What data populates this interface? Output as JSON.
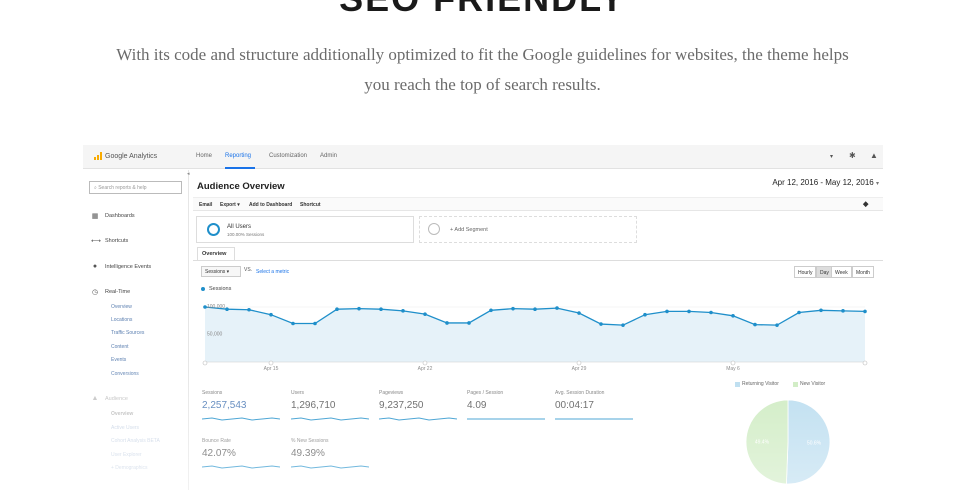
{
  "hero": {
    "title": "SEO FRIENDLY",
    "text": "With its code and structure additionally optimized to fit the Google guidelines for websites, the theme helps you reach the top of search results."
  },
  "ga": {
    "brand": "Google Analytics",
    "nav": [
      "Home",
      "Reporting",
      "Customization",
      "Admin"
    ],
    "active_nav": "Reporting",
    "search_placeholder": "Search reports & help",
    "sidebar": {
      "items": [
        {
          "label": "Dashboards",
          "icon": "grid-icon",
          "glyph": "▦"
        },
        {
          "label": "Shortcuts",
          "icon": "shortcut-arrow-icon",
          "glyph": "⟷"
        },
        {
          "label": "Intelligence Events",
          "icon": "lightbulb-icon",
          "glyph": "●"
        },
        {
          "label": "Real-Time",
          "icon": "clock-icon",
          "glyph": "◷"
        },
        {
          "label": "Audience",
          "icon": "people-icon",
          "glyph": "▲"
        }
      ],
      "realtime_sub": [
        "Overview",
        "Locations",
        "Traffic Sources",
        "Content",
        "Events",
        "Conversions"
      ],
      "audience_sub": [
        "Overview",
        "Active Users",
        "Cohort Analysis BETA",
        "User Explorer",
        "+ Demographics"
      ]
    },
    "page_title": "Audience Overview",
    "date_range": "Apr 12, 2016 - May 12, 2016",
    "toolbar": [
      "Email",
      "Export ▾",
      "Add to Dashboard",
      "Shortcut"
    ],
    "segments": {
      "all_users": "All Users",
      "all_users_pct": "100.00% Sessions",
      "add_segment": "+ Add Segment"
    },
    "overview_tab": "Overview",
    "metric_select": "Sessions ▾",
    "vs": "VS.",
    "select_metric": "Select a metric",
    "granularity": [
      "Hourly",
      "Day",
      "Week",
      "Month"
    ],
    "active_granularity": "Day",
    "legend": "Sessions",
    "summary": [
      {
        "label": "Sessions",
        "value": "2,257,543"
      },
      {
        "label": "Users",
        "value": "1,296,710"
      },
      {
        "label": "Pageviews",
        "value": "9,237,250"
      },
      {
        "label": "Pages / Session",
        "value": "4.09"
      },
      {
        "label": "Avg. Session Duration",
        "value": "00:04:17"
      },
      {
        "label": "Bounce Rate",
        "value": "42.07%"
      },
      {
        "label": "% New Sessions",
        "value": "49.39%"
      }
    ],
    "pie": {
      "legend": [
        "Returning Visitor",
        "New Visitor"
      ],
      "labels": [
        "50.6%",
        "49.4%"
      ],
      "values": [
        50.6,
        49.4
      ]
    },
    "colors": {
      "accent": "#1a73e8",
      "series": "#1f8fca",
      "pie_blue": "#b9dcef",
      "pie_green": "#cdebc0"
    }
  },
  "chart_data": {
    "type": "area",
    "title": "",
    "xlabel": "",
    "ylabel": "",
    "x_ticks": [
      "Apr 15",
      "Apr 22",
      "Apr 29",
      "May 6"
    ],
    "y_ticks": [
      "100,000",
      "50,000"
    ],
    "ylim": [
      0,
      120000
    ],
    "series": [
      {
        "name": "Sessions",
        "values": [
          100000,
          96000,
          95000,
          86000,
          70000,
          70000,
          96000,
          97000,
          96000,
          93000,
          87000,
          71000,
          71000,
          94000,
          97000,
          96000,
          98000,
          89000,
          69000,
          67000,
          86000,
          92000,
          92000,
          90000,
          84000,
          68000,
          67000,
          90000,
          94000,
          93000,
          92000
        ]
      }
    ]
  }
}
